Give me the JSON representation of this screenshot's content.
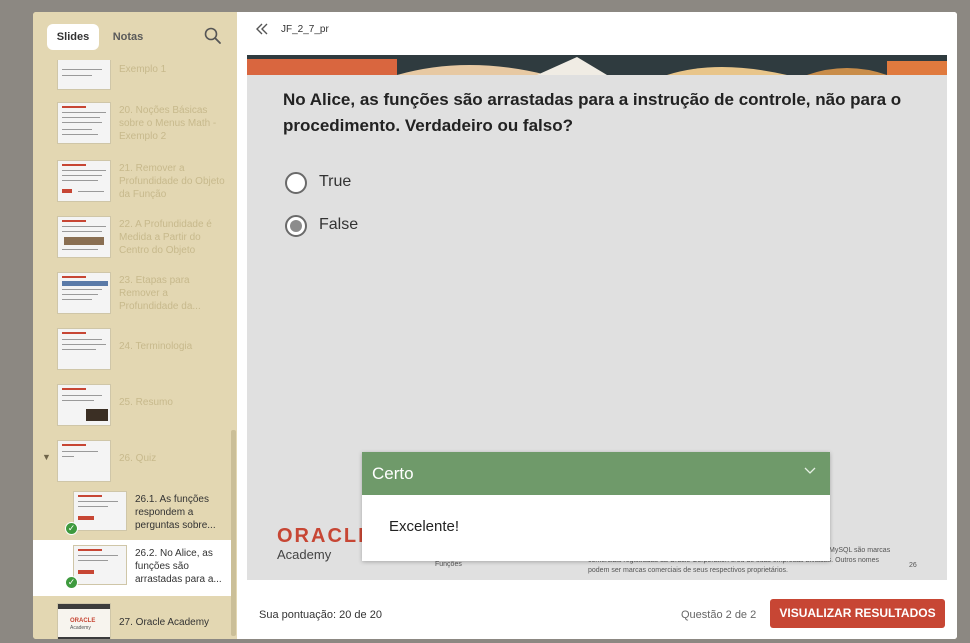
{
  "sidebar": {
    "tabs": [
      {
        "label": "Slides",
        "active": true
      },
      {
        "label": "Notas",
        "active": false
      }
    ],
    "search_icon": "search-icon",
    "slides": [
      {
        "label": "Exemplo 1"
      },
      {
        "label": "20. Noções Básicas sobre o Menus Math - Exemplo 2"
      },
      {
        "label": "21. Remover a Profundidade do Objeto da Função"
      },
      {
        "label": "22. A Profundidade é Medida a Partir do Centro do Objeto"
      },
      {
        "label": "23. Etapas para Remover a Profundidade da..."
      },
      {
        "label": "24. Terminologia"
      },
      {
        "label": "25. Resumo"
      },
      {
        "label": "26. Quiz"
      }
    ],
    "sub_slides": [
      {
        "label": "26.1.  As funções respondem a perguntas sobre...",
        "completed": true,
        "current": false
      },
      {
        "label": "26.2.  No Alice, as funções são arrastadas para a...",
        "completed": true,
        "current": true
      }
    ],
    "last_slide": {
      "label": "27. Oracle Academy",
      "thumb_logo": "ORACLE",
      "thumb_sub": "Academy"
    }
  },
  "topbar": {
    "collapse_icon": "double-chevron-left-icon",
    "title": "JF_2_7_pr"
  },
  "slide": {
    "question": "No Alice, as funções são arrastadas para a instrução de controle, não para o procedimento. Verdadeiro ou falso?",
    "choices": [
      {
        "label": "True",
        "selected": false
      },
      {
        "label": "False",
        "selected": true
      }
    ],
    "footer": {
      "logo": "ORACLE",
      "logo_sub": "Academy",
      "section": "Funções",
      "copyright": "comerciais registradas da Oracle Corporation e/ou de suas empresas afiliadas. Outros nomes podem ser marcas comerciais de seus respectivos proprietários.",
      "copyright_top": "MySQL são marcas",
      "page_number": "26"
    }
  },
  "feedback": {
    "title": "Certo",
    "message": "Excelente!",
    "color": "#6f9a6a"
  },
  "bottombar": {
    "score": "Sua pontuação: 20 de 20",
    "question_count": "Questão 2 de 2",
    "results_button": "VISUALIZAR RESULTADOS"
  },
  "colors": {
    "accent": "#c74634",
    "sidebar_bg": "#e3d7b2",
    "success": "#3e9a3e"
  }
}
